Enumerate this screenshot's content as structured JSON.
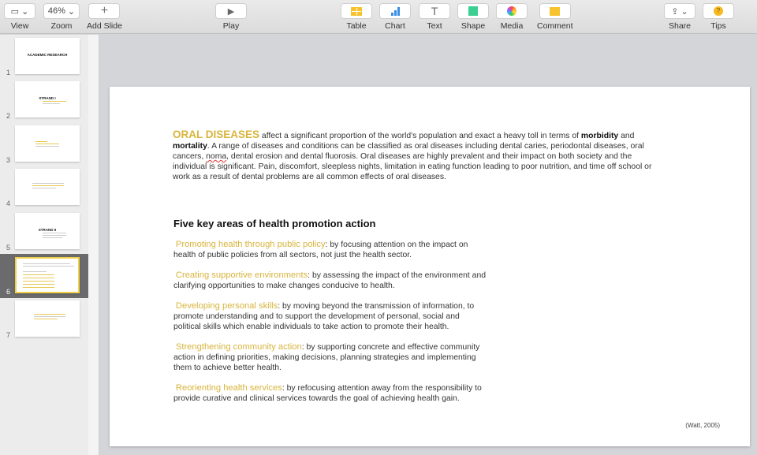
{
  "toolbar": {
    "view": "View",
    "zoom": "Zoom",
    "zoom_value": "46%",
    "add_slide": "Add Slide",
    "play": "Play",
    "table": "Table",
    "chart": "Chart",
    "text": "Text",
    "shape": "Shape",
    "media": "Media",
    "comment": "Comment",
    "share": "Share",
    "tips": "Tips"
  },
  "sidebar": {
    "selected": 6,
    "slides": [
      {
        "num": "1",
        "title": "ACADEMIC RESEARCH"
      },
      {
        "num": "2",
        "title": "STRAND I"
      },
      {
        "num": "3",
        "title": ""
      },
      {
        "num": "4",
        "title": ""
      },
      {
        "num": "5",
        "title": "STRAND II"
      },
      {
        "num": "6",
        "title": ""
      },
      {
        "num": "7",
        "title": ""
      }
    ]
  },
  "slide": {
    "lead": "ORAL DISEASES",
    "p1a": " affect a significant proportion of the world's population and exact a heavy toll in terms of ",
    "bold1": "morbidity",
    "p1b": " and ",
    "bold2": "mortality",
    "p1c": ". A range of diseases and conditions can be classified as oral diseases including dental caries, periodontal diseases, oral cancers, ",
    "noma": "noma",
    "p1d": ", dental erosion and dental fluorosis. Oral diseases are highly prevalent and their impact on both society and the individual is significant. Pain, discomfort, sleepless nights, limitation in eating function leading to poor nutrition, and time off school or work as a result of dental problems are all common effects of oral diseases.",
    "heading": "Five key areas of health promotion action",
    "items": [
      {
        "title": "Promoting health through public policy",
        "text": ": by focusing attention on the impact on health of public policies from all sectors, not just the health sector."
      },
      {
        "title": "Creating supportive environments",
        "text": ": by assessing the impact of the environment and clarifying opportunities to make changes conducive to health."
      },
      {
        "title": "Developing personal skills",
        "text": ": by moving beyond the transmission of information, to promote understanding and to support the development of personal, social and political skills which enable individuals to take action to promote their health."
      },
      {
        "title": "Strengthening community action",
        "text": ": by supporting concrete and effective community action in defining priorities, making decisions, planning strategies and implementing them to achieve better health."
      },
      {
        "title": "Reorienting health services",
        "text": ": by refocusing attention away from the responsibility to provide curative and clinical services towards the goal of achieving health gain."
      }
    ],
    "citation": "(Watt, 2005)",
    "accent": "#d8b43c"
  }
}
